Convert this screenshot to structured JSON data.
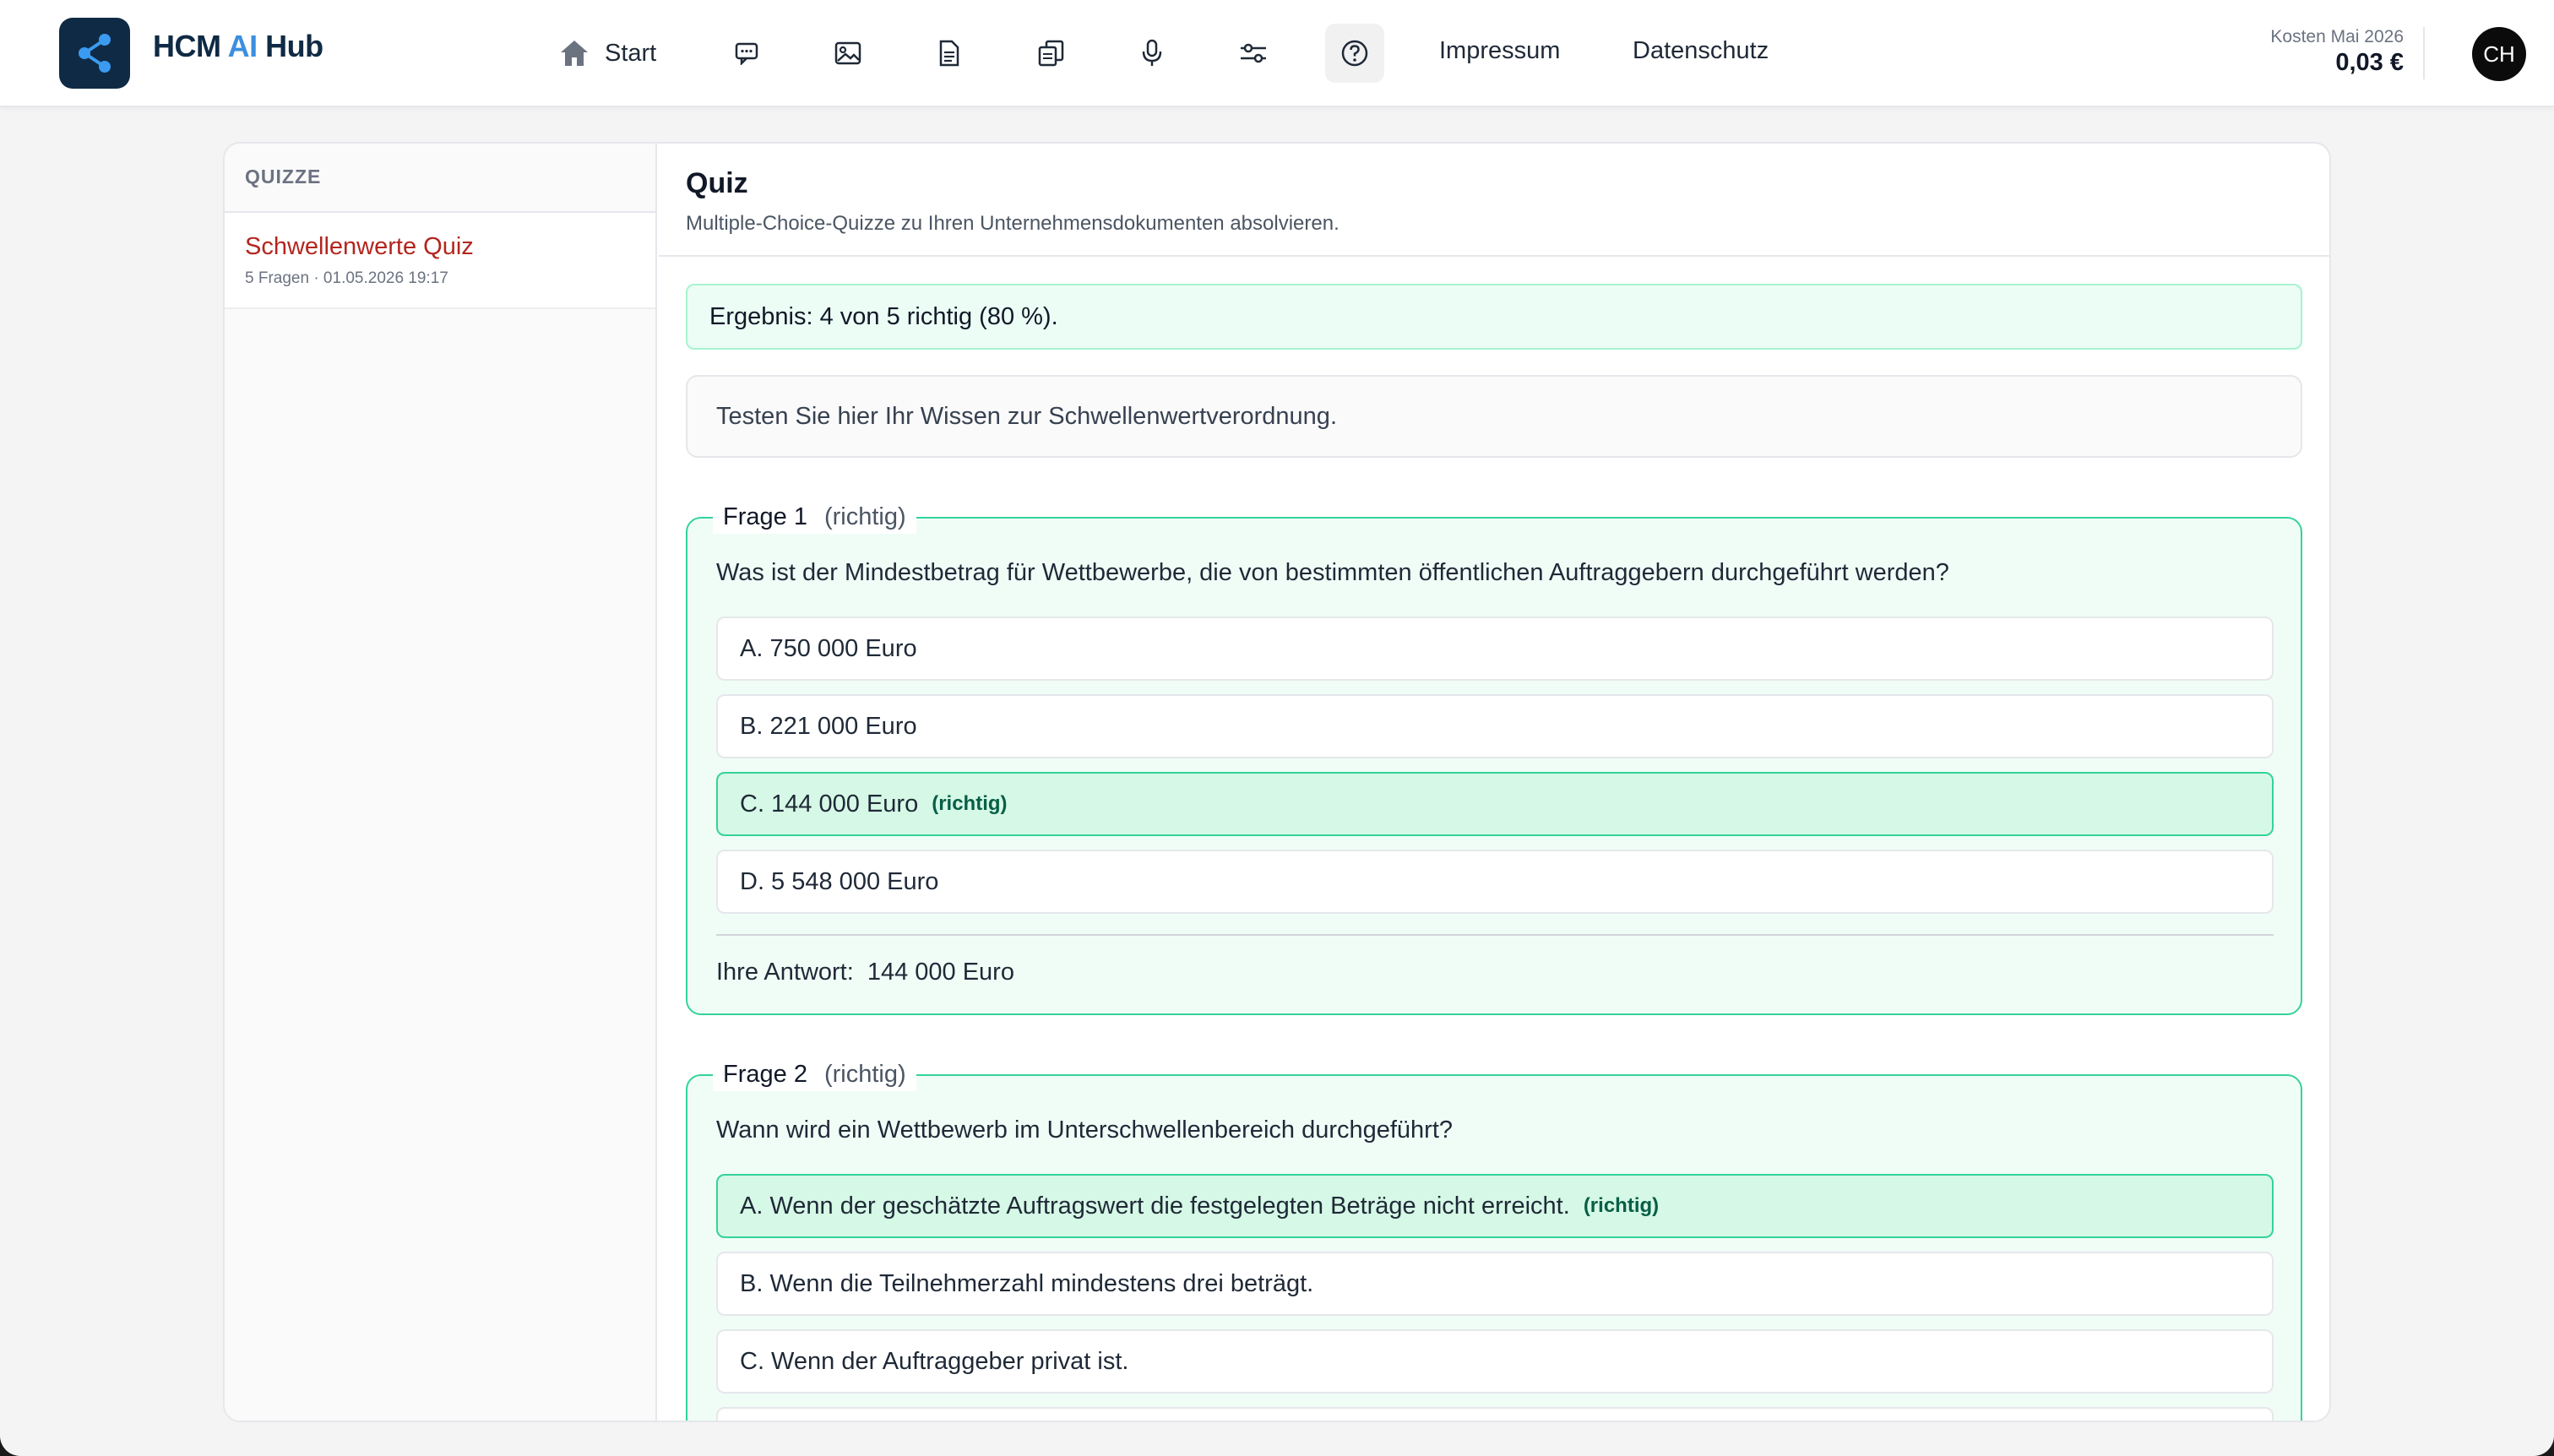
{
  "header": {
    "brand_prefix": "HCM ",
    "brand_ai": "AI",
    "brand_suffix": " Hub",
    "nav_start": "Start",
    "nav_icons": [
      "chat-icon",
      "image-icon",
      "document-icon",
      "documents-icon",
      "microphone-icon",
      "sliders-icon",
      "help-icon"
    ],
    "link_impressum": "Impressum",
    "link_datenschutz": "Datenschutz",
    "cost_label": "Kosten Mai 2026",
    "cost_value": "0,03 €",
    "avatar_initials": "CH"
  },
  "sidebar": {
    "heading": "QUIZZE",
    "items": [
      {
        "title": "Schwellenwerte Quiz",
        "meta": "5 Fragen · 01.05.2026 19:17"
      }
    ]
  },
  "content": {
    "title": "Quiz",
    "subtitle": "Multiple-Choice-Quizze zu Ihren Unternehmensdokumenten absolvieren.",
    "result": "Ergebnis: 4 von 5 richtig (80 %).",
    "intro": "Testen Sie hier Ihr Wissen zur Schwellenwertverordnung.",
    "questions": [
      {
        "label": "Frage 1",
        "status": "(richtig)",
        "text": "Was ist der Mindestbetrag für Wettbewerbe, die von bestimmten öffentlichen Auftraggebern durchgeführt werden?",
        "options": [
          {
            "text": "A. 750 000 Euro",
            "tag": ""
          },
          {
            "text": "B. 221 000 Euro",
            "tag": ""
          },
          {
            "text": "C. 144 000 Euro",
            "tag": "(richtig)"
          },
          {
            "text": "D. 5 548 000 Euro",
            "tag": ""
          }
        ],
        "answer_label": "Ihre Antwort:",
        "answer_value": "144 000 Euro"
      },
      {
        "label": "Frage 2",
        "status": "(richtig)",
        "text": "Wann wird ein Wettbewerb im Unterschwellenbereich durchgeführt?",
        "options": [
          {
            "text": "A. Wenn der geschätzte Auftragswert die festgelegten Beträge nicht erreicht.",
            "tag": "(richtig)"
          },
          {
            "text": "B. Wenn die Teilnehmerzahl mindestens drei beträgt.",
            "tag": ""
          },
          {
            "text": "C. Wenn der Auftraggeber privat ist.",
            "tag": ""
          }
        ]
      }
    ]
  }
}
